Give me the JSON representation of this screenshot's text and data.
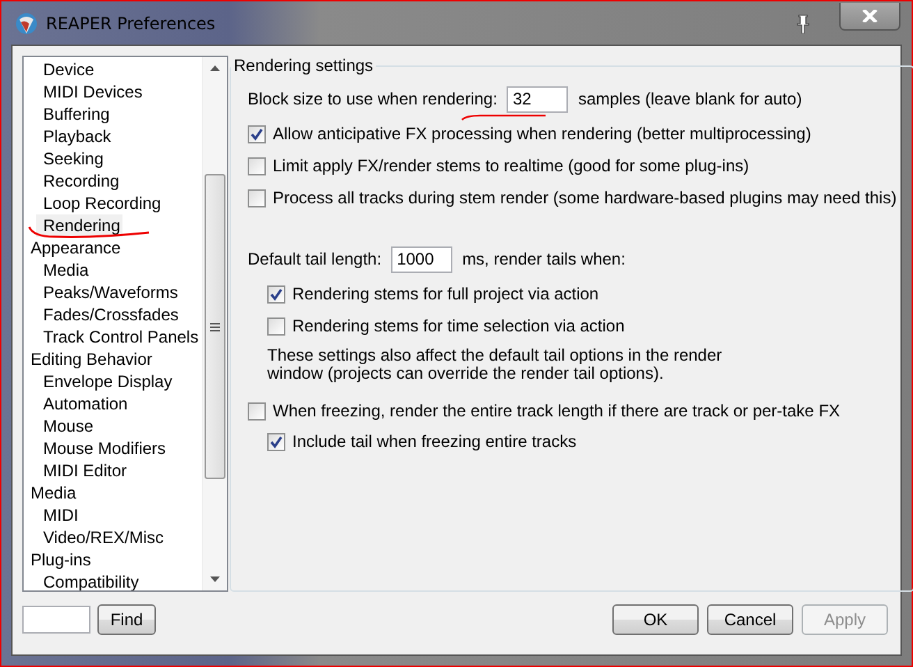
{
  "window": {
    "title": "REAPER Preferences"
  },
  "sidebar": {
    "items": [
      {
        "children": [
          {
            "label": "Device",
            "selected": false
          },
          {
            "label": "MIDI Devices",
            "selected": false
          },
          {
            "label": "Buffering",
            "selected": false
          },
          {
            "label": "Playback",
            "selected": false
          },
          {
            "label": "Seeking",
            "selected": false
          },
          {
            "label": "Recording",
            "selected": false
          },
          {
            "label": "Loop Recording",
            "selected": false
          },
          {
            "label": "Rendering",
            "selected": true
          }
        ]
      },
      {
        "label": "Appearance",
        "selected": false,
        "children": [
          {
            "label": "Media",
            "selected": false
          },
          {
            "label": "Peaks/Waveforms",
            "selected": false
          },
          {
            "label": "Fades/Crossfades",
            "selected": false
          },
          {
            "label": "Track Control Panels",
            "selected": false
          }
        ]
      },
      {
        "label": "Editing Behavior",
        "selected": false,
        "children": [
          {
            "label": "Envelope Display",
            "selected": false
          },
          {
            "label": "Automation",
            "selected": false
          },
          {
            "label": "Mouse",
            "selected": false
          },
          {
            "label": "Mouse Modifiers",
            "selected": false
          },
          {
            "label": "MIDI Editor",
            "selected": false
          }
        ]
      },
      {
        "label": "Media",
        "selected": false,
        "children": [
          {
            "label": "MIDI",
            "selected": false
          },
          {
            "label": "Video/REX/Misc",
            "selected": false
          }
        ]
      },
      {
        "label": "Plug-ins",
        "selected": false,
        "children": [
          {
            "label": "Compatibility",
            "selected": false
          }
        ]
      }
    ]
  },
  "find_button": "Find",
  "settings": {
    "title": "Rendering settings",
    "rows": [
      {
        "kind": "field",
        "label": "Block size to use when rendering:",
        "value": "32",
        "suffix": "samples (leave blank for auto)"
      },
      {
        "kind": "checkbox",
        "label": "Allow anticipative FX processing when rendering (better multiprocessing)",
        "checked": true
      },
      {
        "kind": "checkbox",
        "label": "Limit apply FX/render stems to realtime (good for some plug-ins)",
        "checked": false
      },
      {
        "kind": "checkbox",
        "label": "Process all tracks during stem render (some hardware-based plugins may need this)",
        "checked": false
      },
      {
        "kind": "field",
        "label": "Default tail length:",
        "value": "1000",
        "suffix": "ms, render tails when:",
        "children": [
          {
            "kind": "checkbox",
            "label": "Rendering stems for full project via action",
            "checked": true
          },
          {
            "kind": "checkbox",
            "label": "Rendering stems for time selection via action",
            "checked": false
          },
          {
            "kind": "note",
            "label": "These settings also affect the default tail options in the render window (projects can override the render tail options)."
          }
        ]
      },
      {
        "kind": "checkbox",
        "label": "When freezing, render the entire track length if there are track or per-take FX",
        "checked": false,
        "children": [
          {
            "kind": "checkbox",
            "label": "Include tail when freezing entire tracks",
            "checked": true
          }
        ]
      }
    ]
  },
  "buttons": [
    {
      "label": "OK",
      "disabled": false
    },
    {
      "label": "Cancel",
      "disabled": false
    },
    {
      "label": "Apply",
      "disabled": true
    }
  ]
}
